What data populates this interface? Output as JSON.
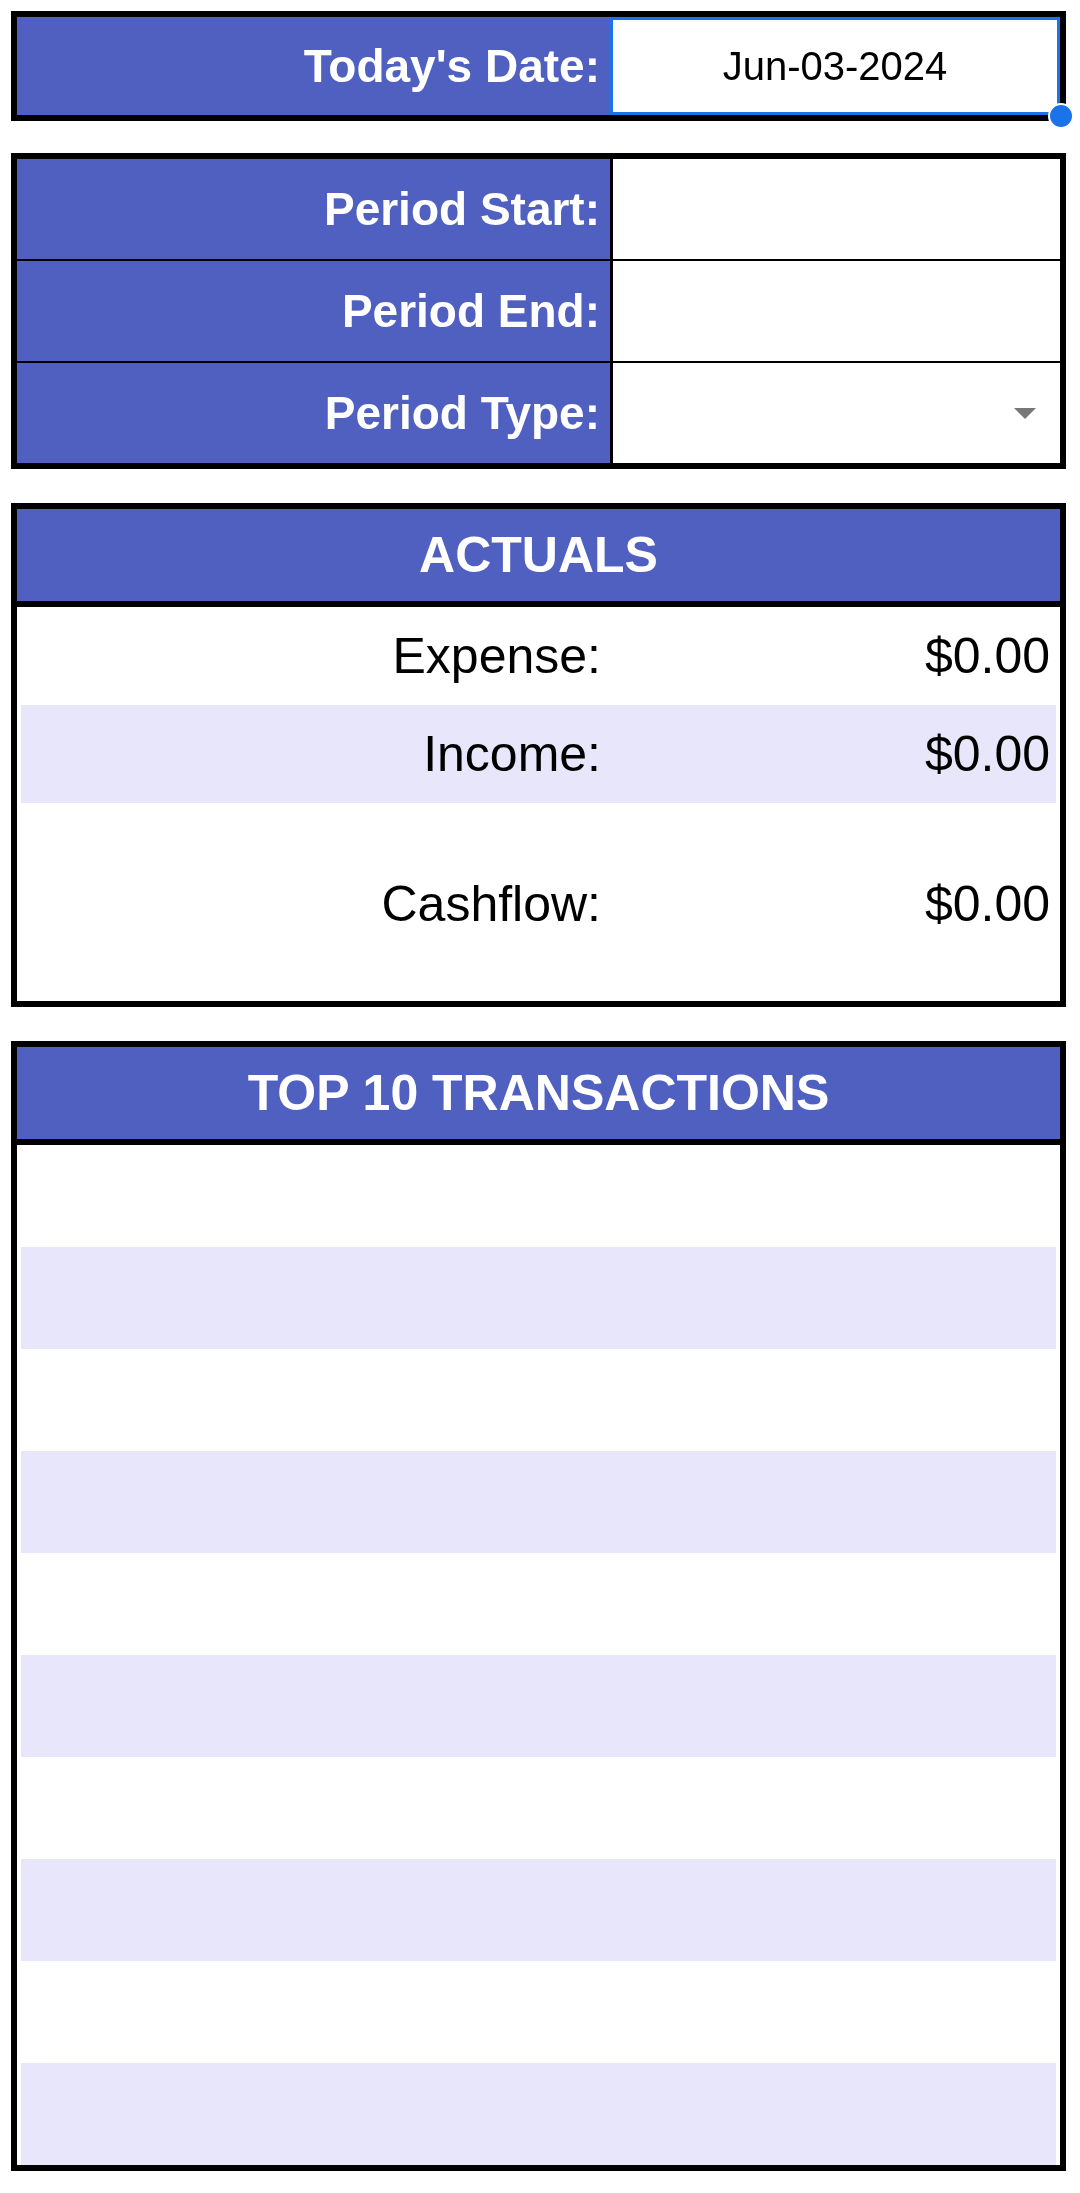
{
  "today": {
    "label": "Today's Date:",
    "value": "Jun-03-2024",
    "selected": true
  },
  "period": {
    "fields": [
      {
        "label": "Period Start:",
        "kind": "text"
      },
      {
        "label": "Period End:",
        "kind": "text"
      },
      {
        "label": "Period Type:",
        "kind": "dropdown"
      }
    ]
  },
  "actuals": {
    "title": "ACTUALS",
    "rows": [
      {
        "label": "Expense:",
        "value": "$0.00",
        "kind": "line"
      },
      {
        "label": "Income:",
        "value": "$0.00",
        "kind": "line"
      },
      {
        "label": "Cashflow:",
        "value": "$0.00",
        "kind": "total"
      }
    ]
  },
  "transactions": {
    "title": "TOP 10 TRANSACTIONS"
  }
}
